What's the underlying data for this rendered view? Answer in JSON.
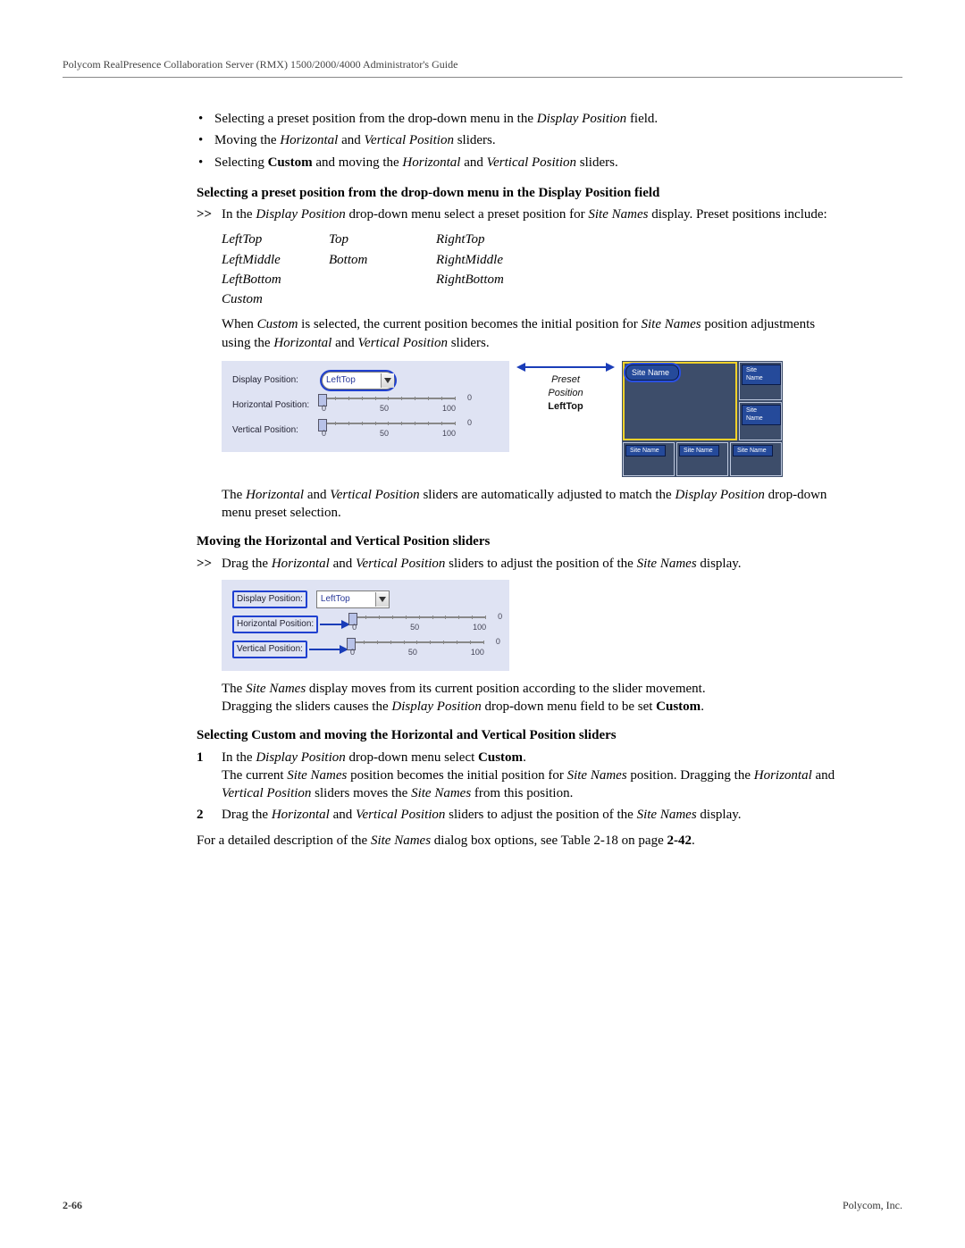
{
  "header": "Polycom RealPresence Collaboration Server (RMX) 1500/2000/4000 Administrator's Guide",
  "intro_bullets": [
    {
      "pre": "Selecting a preset position from the drop-down menu in the ",
      "em": "Display Position",
      "post": " field."
    },
    {
      "pre": "Moving the ",
      "em": "Horizontal",
      "mid": " and ",
      "em2": "Vertical Position",
      "post": " sliders."
    },
    {
      "pre": "Selecting ",
      "b": "Custom",
      "mid": " and moving the ",
      "em": "Horizontal",
      "mid2": " and ",
      "em2": "Vertical Position",
      "post": " sliders."
    }
  ],
  "sec1_title": "Selecting a preset position from the drop-down menu in the Display Position field",
  "sec1_lead_pre": "In the ",
  "sec1_lead_em1": "Display Position",
  "sec1_lead_mid": " drop-down menu select a preset position for ",
  "sec1_lead_em2": "Site Names",
  "sec1_lead_post": " display. Preset positions include:",
  "presets": {
    "col1": [
      "LeftTop",
      "LeftMiddle",
      "LeftBottom",
      "Custom"
    ],
    "col2": [
      "Top",
      "",
      "Bottom",
      ""
    ],
    "col3": [
      "RightTop",
      "RightMiddle",
      "RightBottom",
      ""
    ]
  },
  "sec1_p2_pre": "When ",
  "sec1_p2_em1": "Custom",
  "sec1_p2_mid": " is selected, the current position becomes the initial position for ",
  "sec1_p2_em2": "Site Names",
  "sec1_p2_mid2": " position adjustments using the ",
  "sec1_p2_em3": "Horizontal",
  "sec1_p2_mid3": " and ",
  "sec1_p2_em4": "Vertical Position",
  "sec1_p2_post": " sliders.",
  "panel": {
    "dp_label": "Display Position:",
    "dp_value": "LeftTop",
    "hp_label": "Horizontal Position:",
    "vp_label": "Vertical Position:",
    "s_min": "0",
    "s_mid": "50",
    "s_max": "100",
    "s_val": "0"
  },
  "annot": {
    "preset": "Preset",
    "position": "Position",
    "lefttop": "LeftTop"
  },
  "layout_label": "Site Name",
  "sec1_p3_pre": "The ",
  "sec1_p3_em1": "Horizontal",
  "sec1_p3_mid": " and ",
  "sec1_p3_em2": "Vertical Position",
  "sec1_p3_mid2": " sliders are automatically adjusted to match the ",
  "sec1_p3_em3": "Display Position",
  "sec1_p3_post": " drop-down menu preset selection.",
  "sec2_title": "Moving the Horizontal and Vertical Position sliders",
  "sec2_lead_pre": "Drag the ",
  "sec2_lead_em1": "Horizontal",
  "sec2_lead_mid": " and ",
  "sec2_lead_em2": "Vertical Position",
  "sec2_lead_mid2": " sliders to adjust the position of the ",
  "sec2_lead_em3": "Site Names",
  "sec2_lead_post": " display.",
  "sec2_p2_pre": "The ",
  "sec2_p2_em": "Site Names",
  "sec2_p2_post": " display moves from its current position according to the slider movement.",
  "sec2_p3_pre": "Dragging the sliders causes the ",
  "sec2_p3_em": "Display Position",
  "sec2_p3_mid": " drop-down menu field to be set ",
  "sec2_p3_b": "Custom",
  "sec2_p3_post": ".",
  "sec3_title": "Selecting Custom and moving the Horizontal and Vertical Position sliders",
  "step1_pre": "In the ",
  "step1_em": "Display Position",
  "step1_mid": " drop-down menu select ",
  "step1_b": "Custom",
  "step1_post": ".",
  "step1_p2_pre": "The current ",
  "step1_p2_em1": "Site Names",
  "step1_p2_mid": " position becomes the initial position for ",
  "step1_p2_em2": "Site Names",
  "step1_p2_mid2": " position. Dragging the ",
  "step1_p2_em3": "Horizontal",
  "step1_p2_mid3": " and ",
  "step1_p2_em4": "Vertical Position",
  "step1_p2_mid4": " sliders moves the ",
  "step1_p2_em5": "Site Names",
  "step1_p2_post": " from this position.",
  "step2_pre": "Drag the ",
  "step2_em1": "Horizontal",
  "step2_mid": " and ",
  "step2_em2": "Vertical Position",
  "step2_mid2": " sliders to adjust the position of the ",
  "step2_em3": "Site Names",
  "step2_post": " display.",
  "final_pre": "For a detailed description of the ",
  "final_em": "Site Names",
  "final_mid": " dialog box options, see Table 2-18 on page ",
  "final_link": "2-42",
  "final_post": ".",
  "footer": {
    "page": "2-66",
    "company": "Polycom, Inc."
  },
  "arrow_marker": ">>",
  "step_numbers": [
    "1",
    "2"
  ]
}
